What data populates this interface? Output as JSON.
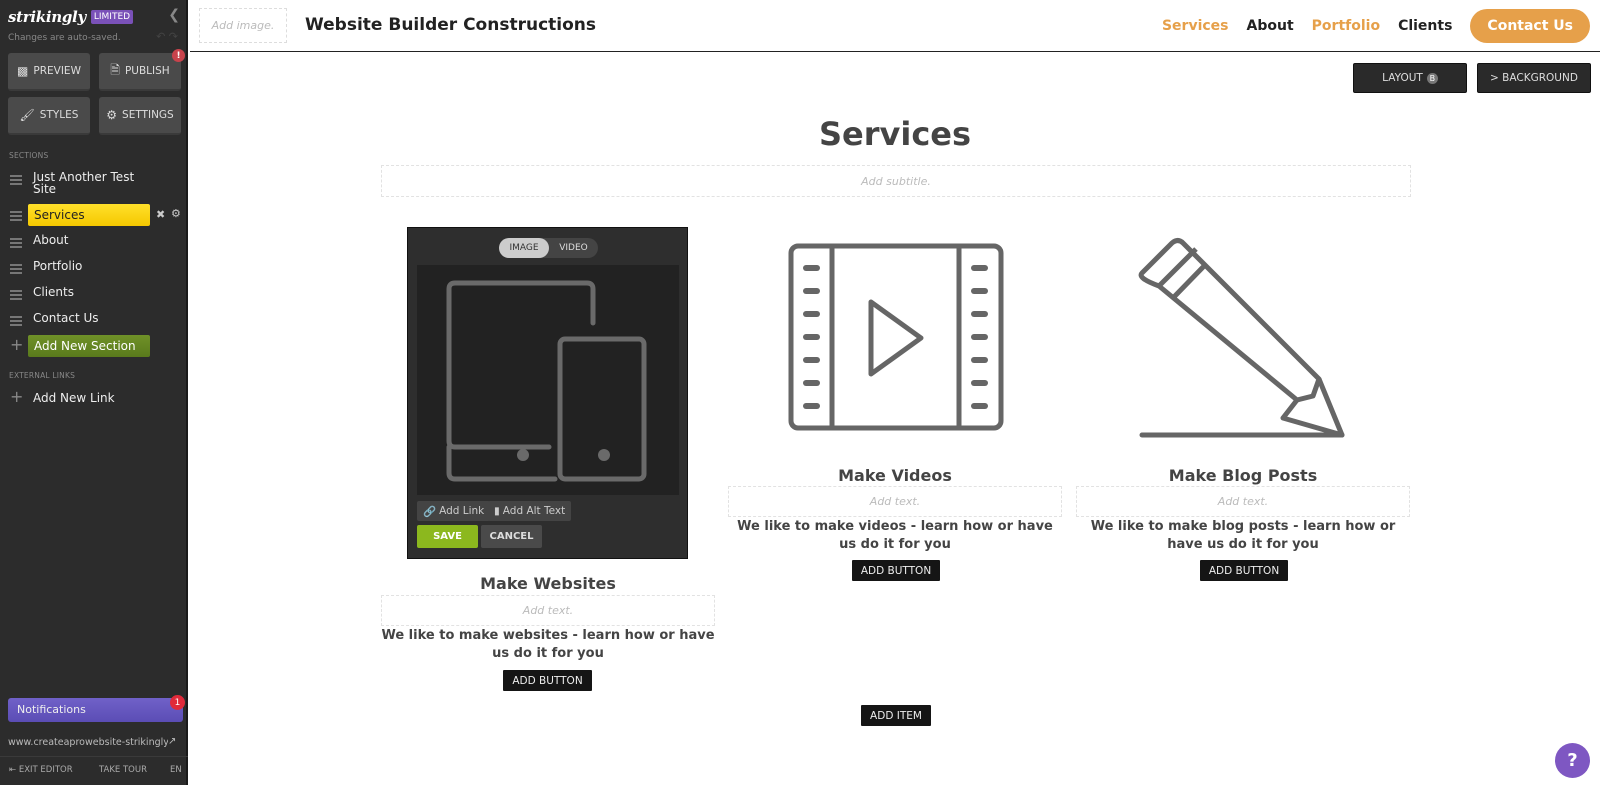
{
  "sidebar": {
    "logo": "strikingly",
    "plan_badge": "LIMITED",
    "autosave_status": "Changes are auto-saved.",
    "buttons": {
      "preview": "PREVIEW",
      "publish": "PUBLISH",
      "publish_alert": "!",
      "styles": "STYLES",
      "settings": "SETTINGS"
    },
    "sections_heading": "SECTIONS",
    "sections": [
      {
        "label": "Just Another Test Site"
      },
      {
        "label": "Services",
        "active": true
      },
      {
        "label": "About"
      },
      {
        "label": "Portfolio"
      },
      {
        "label": "Clients"
      },
      {
        "label": "Contact Us"
      }
    ],
    "add_section": "Add New Section",
    "external_links_heading": "EXTERNAL LINKS",
    "add_link": "Add New Link",
    "notifications": {
      "label": "Notifications",
      "count": "1"
    },
    "site_url": "www.createaprowebsite-strikingly.com",
    "footer": {
      "exit": "EXIT EDITOR",
      "tour": "TAKE TOUR",
      "lang": "EN"
    }
  },
  "header": {
    "add_image_placeholder": "Add image.",
    "site_title": "Website Builder Constructions",
    "nav": [
      {
        "label": "Services",
        "color": "#e6a04a"
      },
      {
        "label": "About",
        "color": "#222222"
      },
      {
        "label": "Portfolio",
        "color": "#e6a04a"
      },
      {
        "label": "Clients",
        "color": "#222222"
      }
    ],
    "cta": "Contact Us"
  },
  "section_controls": {
    "layout": "LAYOUT",
    "layout_badge": "B",
    "background": "> BACKGROUND"
  },
  "section": {
    "title": "Services",
    "subtitle_placeholder": "Add subtitle.",
    "add_item": "ADD ITEM"
  },
  "media_editor": {
    "tabs": [
      "IMAGE",
      "VIDEO"
    ],
    "active_tab": "IMAGE",
    "add_link": "Add Link",
    "add_alt_text": "Add Alt Text",
    "save": "SAVE",
    "cancel": "CANCEL"
  },
  "items": [
    {
      "title": "Make Websites",
      "text_placeholder": "Add text.",
      "description": "We like to make websites - learn how or have us do it for you",
      "button": "ADD BUTTON",
      "icon": "devices-icon"
    },
    {
      "title": "Make Videos",
      "text_placeholder": "Add text.",
      "description": "We like to make videos - learn how or have us do it for you",
      "button": "ADD BUTTON",
      "icon": "film-play-icon"
    },
    {
      "title": "Make Blog Posts",
      "text_placeholder": "Add text.",
      "description": "We like to make blog posts - learn how or have us do it for you",
      "button": "ADD BUTTON",
      "icon": "pencil-icon"
    }
  ],
  "help": "?",
  "colors": {
    "accent": "#e6a04a",
    "active_section": "#ffd800",
    "add_section": "#6a8c22",
    "save": "#8cb81e",
    "notifications": "#6a5acd",
    "help": "#7e57c2"
  }
}
